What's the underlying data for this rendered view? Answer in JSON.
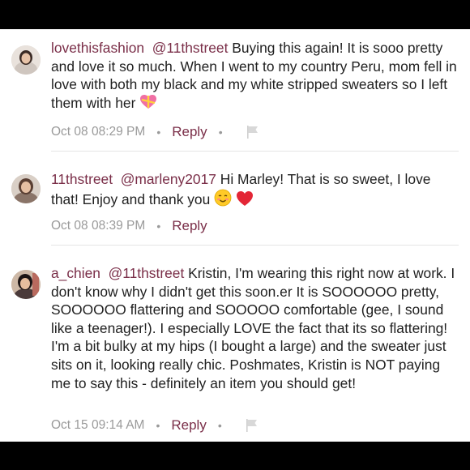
{
  "comments": [
    {
      "username": "lovethisfashion",
      "mention": "@11thstreet",
      "text": "Buying this again! It is sooo pretty and love it so much. When I went to my country Peru, mom fell in love with both my black and my white stripped sweaters so I left them with her",
      "emoji": "gift-heart-emoji",
      "timestamp": "Oct 08 08:29 PM",
      "reply_label": "Reply",
      "has_flag": true
    },
    {
      "username": "11thstreet",
      "mention": "@marleny2017",
      "text": "Hi Marley! That is so sweet, I love that! Enjoy and thank you",
      "emoji": "smiling-face-emoji red-heart-emoji",
      "timestamp": "Oct 08 08:39 PM",
      "reply_label": "Reply",
      "has_flag": false
    },
    {
      "username": "a_chien",
      "mention": "@11thstreet",
      "text": "Kristin, I'm wearing this right now at work. I don't know why I didn't get this soon.er It is SOOOOOO pretty, SOOOOOO flattering and SOOOOO comfortable (gee, I sound like a teenager!). I especially LOVE the fact that its so flattering! I'm a bit bulky at my hips (I bought a large) and the sweater just sits on it, looking really chic. Poshmates, Kristin is NOT paying me to say this - definitely an item you should get!",
      "emoji": "",
      "timestamp": "Oct 15 09:14 AM",
      "reply_label": "Reply",
      "has_flag": true
    }
  ],
  "colors": {
    "handle": "#7a2e48",
    "text": "#1f1f1f",
    "meta": "#9a9a9a",
    "background": "#ffffff",
    "letterbox": "#000000"
  }
}
